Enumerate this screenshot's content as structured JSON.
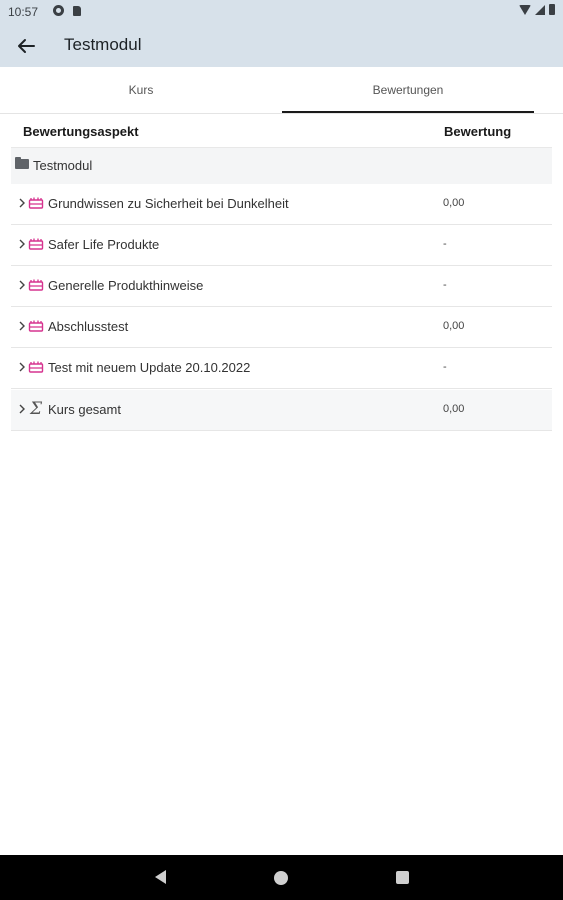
{
  "status_bar": {
    "time": "10:57",
    "left_icons": [
      "dnd-icon",
      "sd-card-icon"
    ],
    "right_icons": [
      "wifi-icon",
      "signal-icon",
      "battery-icon"
    ]
  },
  "app_bar": {
    "back_icon": "arrow-left-icon",
    "title": "Testmodul"
  },
  "tabs": [
    {
      "label": "Kurs",
      "active": false
    },
    {
      "label": "Bewertungen",
      "active": true
    }
  ],
  "table": {
    "headers": {
      "aspect": "Bewertungsaspekt",
      "grade": "Bewertung"
    },
    "module": {
      "icon": "folder-icon",
      "label": "Testmodul"
    },
    "rows": [
      {
        "icon": "assignment-icon",
        "name": "Grundwissen zu Sicherheit bei Dunkelheit",
        "grade": "0,00"
      },
      {
        "icon": "assignment-icon",
        "name": "Safer Life Produkte",
        "grade": "-"
      },
      {
        "icon": "assignment-icon",
        "name": "Generelle Produkthinweise",
        "grade": "-"
      },
      {
        "icon": "assignment-icon",
        "name": "Abschlusstest",
        "grade": "0,00"
      },
      {
        "icon": "assignment-icon",
        "name": "Test mit neuem Update 20.10.2022",
        "grade": "-"
      }
    ],
    "total": {
      "icon": "sigma-icon",
      "name": "Kurs gesamt",
      "grade": "0,00"
    }
  },
  "colors": {
    "app_bar_bg": "#d7e1ea",
    "activity_icon": "#d6338f",
    "nav_bar_bg": "#000000"
  }
}
